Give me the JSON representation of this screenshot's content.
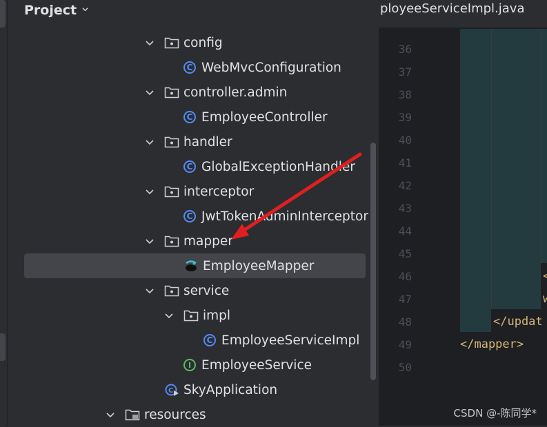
{
  "panel": {
    "title": "Project"
  },
  "tree": [
    {
      "label": "config",
      "type": "package",
      "depth": 0,
      "expanded": true
    },
    {
      "label": "WebMvcConfiguration",
      "type": "class",
      "depth": 1
    },
    {
      "label": "controller.admin",
      "type": "package",
      "depth": 0,
      "expanded": true
    },
    {
      "label": "EmployeeController",
      "type": "class",
      "depth": 1
    },
    {
      "label": "handler",
      "type": "package",
      "depth": 0,
      "expanded": true
    },
    {
      "label": "GlobalExceptionHandler",
      "type": "class",
      "depth": 1
    },
    {
      "label": "interceptor",
      "type": "package",
      "depth": 0,
      "expanded": true
    },
    {
      "label": "JwtTokenAdminInterceptor",
      "type": "class",
      "depth": 1
    },
    {
      "label": "mapper",
      "type": "package",
      "depth": 0,
      "expanded": true
    },
    {
      "label": "EmployeeMapper",
      "type": "mapper",
      "depth": 1,
      "selected": true
    },
    {
      "label": "service",
      "type": "package",
      "depth": 0,
      "expanded": true
    },
    {
      "label": "impl",
      "type": "package",
      "depth": 1,
      "expanded": true
    },
    {
      "label": "EmployeeServiceImpl",
      "type": "class",
      "depth": 2
    },
    {
      "label": "EmployeeService",
      "type": "interface",
      "depth": 1
    },
    {
      "label": "SkyApplication",
      "type": "app",
      "depth": 0
    },
    {
      "label": "resources",
      "type": "resources",
      "depth": -1,
      "expanded": true
    }
  ],
  "editor": {
    "tab_title": "ployeeServiceImpl.java",
    "line_numbers": [
      "36",
      "37",
      "38",
      "39",
      "40",
      "41",
      "42",
      "43",
      "44",
      "45",
      "46",
      "47",
      "48",
      "49",
      "50"
    ],
    "code_lines": [
      {
        "line": "46",
        "text": "<"
      },
      {
        "line": "47",
        "text": "w"
      },
      {
        "line": "48",
        "text": "</updat"
      },
      {
        "line": "49",
        "text": "</mapper>"
      }
    ]
  },
  "watermark": "CSDN @-陈同学*",
  "colors": {
    "panel_bg": "#2b2d30",
    "editor_bg": "#1e1f22",
    "selection": "#43454a",
    "class_icon": "#548af7",
    "interface_icon": "#5fb865",
    "tag_text": "#d5b778",
    "annotation_arrow": "#e02020"
  }
}
